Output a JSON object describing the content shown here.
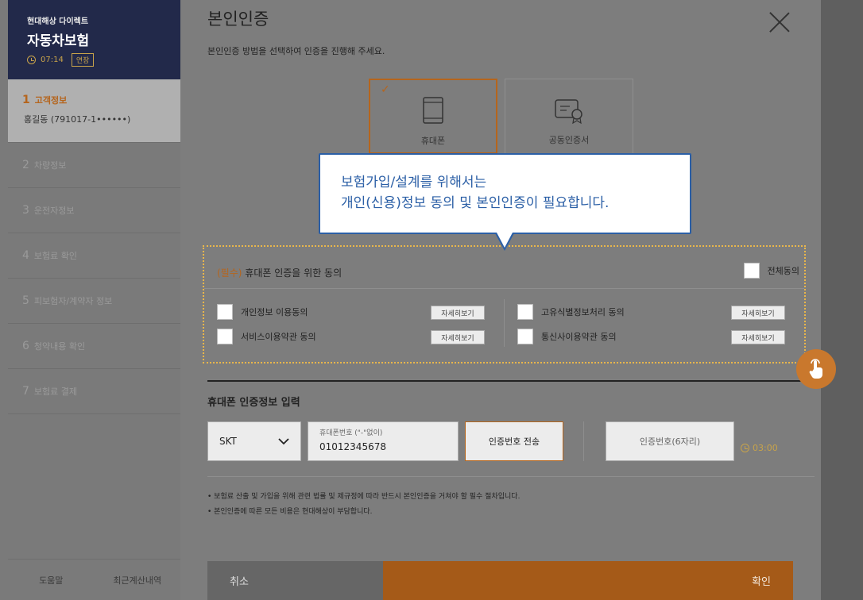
{
  "sidebar": {
    "company": "현대해상 다이렉트",
    "product": "자동차보험",
    "timer": "07:14",
    "extend_label": "연장",
    "steps": [
      {
        "num": "1",
        "label": "고객정보",
        "sub": "홍길동 (791017-1••••••)"
      },
      {
        "num": "2",
        "label": "차량정보"
      },
      {
        "num": "3",
        "label": "운전자정보"
      },
      {
        "num": "4",
        "label": "보험료 확인"
      },
      {
        "num": "5",
        "label": "피보험자/계약자 정보"
      },
      {
        "num": "6",
        "label": "청약내용 확인"
      },
      {
        "num": "7",
        "label": "보험료 결제"
      }
    ],
    "footer": {
      "help": "도움말",
      "recent": "최근계산내역"
    }
  },
  "modal": {
    "title": "본인인증",
    "description": "본인인증 방법을 선택하여 인증을 진행해 주세요.",
    "methods": [
      {
        "label": "휴대폰",
        "selected": true,
        "icon": "mobile-phone-icon"
      },
      {
        "label": "공동인증서",
        "selected": false,
        "icon": "certificate-icon"
      }
    ],
    "tooltip": {
      "line1": "보험가입/설계를 위해서는",
      "line2": "개인(신용)정보 동의 및 본인인증이 필요합니다."
    },
    "consent": {
      "required_tag": "(필수)",
      "heading": "휴대폰 인증을 위한 동의",
      "all_agree": "전체동의",
      "detail_label": "자세히보기",
      "items": [
        "개인정보 이용동의",
        "서비스이용약관 동의",
        "고유식별정보처리 동의",
        "통신사이용약관 동의"
      ]
    },
    "phone": {
      "section_title": "휴대폰 인증정보 입력",
      "carrier": "SKT",
      "phone_label": "휴대폰번호 (\"-\"없이)",
      "phone_value": "01012345678",
      "send_label": "인증번호 전송",
      "code_placeholder": "인증번호(6자리)",
      "countdown": "03:00"
    },
    "notes": [
      "• 보험료 산출 및 가입을 위해 관련 법률 및 제규정에 따라 반드시 본인인증을 거쳐야 할 필수 절차입니다.",
      "• 본인인증에 따른 모든 비용은 현대해상이 부담합니다."
    ],
    "buttons": {
      "cancel": "취소",
      "confirm": "확인"
    }
  },
  "colors": {
    "brand_navy": "#22294a",
    "accent_orange": "#b5651d",
    "tooltip_blue": "#2b5fa6"
  }
}
